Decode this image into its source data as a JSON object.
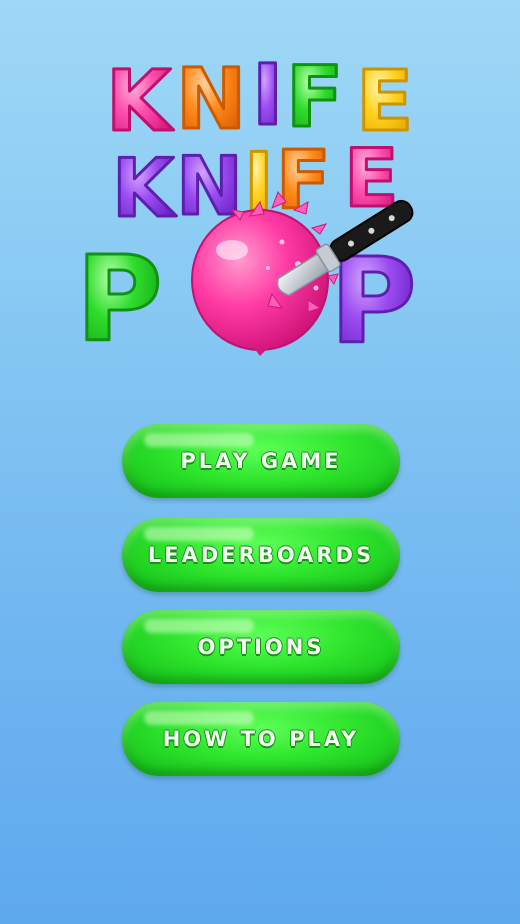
{
  "logo": {
    "line1": "KNIFE",
    "line2": "KNIFE",
    "line3": "POP"
  },
  "menu": {
    "items": [
      {
        "label": "PLAY GAME"
      },
      {
        "label": "LEADERBOARDS"
      },
      {
        "label": "OPTIONS"
      },
      {
        "label": "HOW TO PLAY"
      }
    ]
  },
  "colors": {
    "background_top": "#9fd8f6",
    "background_bottom": "#5ea8ee",
    "button_green": "#2fe52d",
    "balloon_pink": "#ff3aa4",
    "letter_purple": "#9b4cf0",
    "letter_orange": "#ff8a1a",
    "letter_yellow": "#ffd21f",
    "letter_green": "#2fdc2c"
  }
}
